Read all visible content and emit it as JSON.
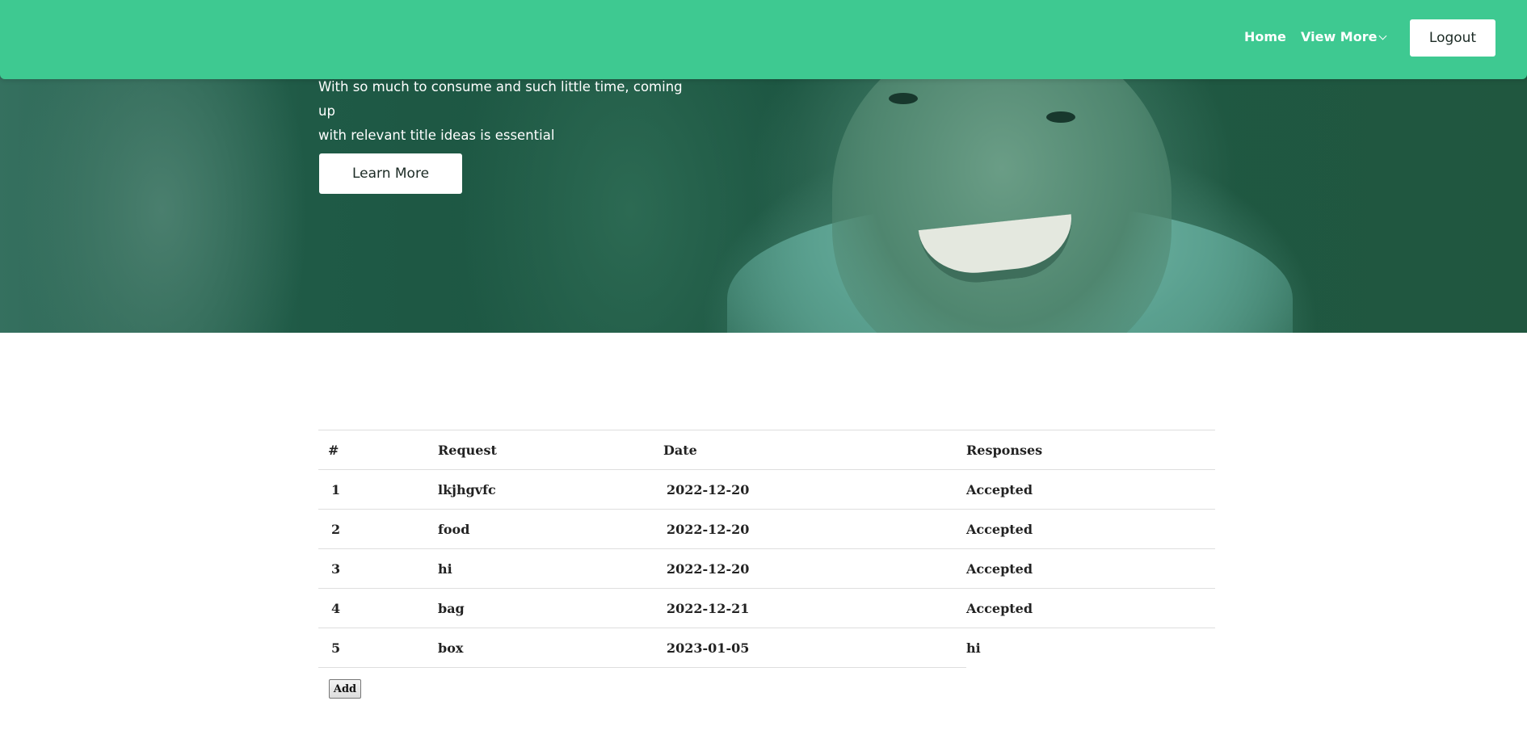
{
  "nav": {
    "home": "Home",
    "view_more": "View More",
    "logout": "Logout"
  },
  "hero": {
    "line1": "With so much to consume and such little time, coming up",
    "line2": "with relevant title ideas is essential",
    "cta": "Learn More"
  },
  "table": {
    "headers": [
      "#",
      "Request",
      "Date",
      "Responses"
    ],
    "rows": [
      [
        "1",
        "lkjhgvfc",
        "2022-12-20",
        "Accepted"
      ],
      [
        "2",
        "food",
        "2022-12-20",
        "Accepted"
      ],
      [
        "3",
        "hi",
        "2022-12-20",
        "Accepted"
      ],
      [
        "4",
        "bag",
        "2022-12-21",
        "Accepted"
      ],
      [
        "5",
        "box",
        "2023-01-05",
        "hi"
      ]
    ]
  },
  "add_label": "Add",
  "colors": {
    "navbar": "#3ec991",
    "hero_overlay": "#1f5a46"
  }
}
